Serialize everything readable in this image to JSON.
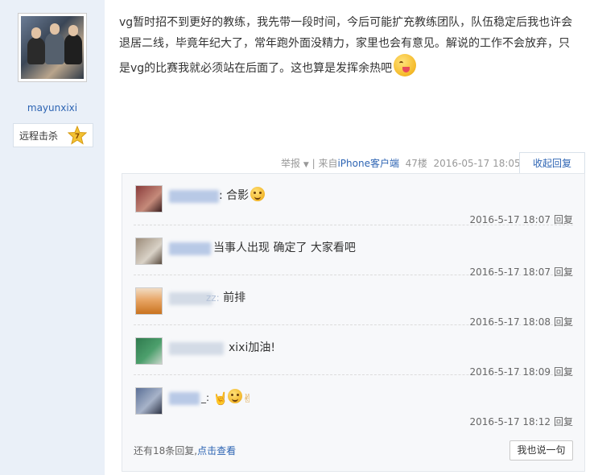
{
  "user": {
    "name": "mayunxixi",
    "badge_label": "远程击杀",
    "badge_level": "7"
  },
  "post": {
    "text": "vg暂时招不到更好的教练，我先带一段时间，今后可能扩充教练团队，队伍稳定后我也许会退居二线，毕竟年纪大了，常年跑外面没精力，家里也会有意见。解说的工作不会放弃，只是vg的比赛我就必须站在后面了。这也算是发挥余热吧"
  },
  "meta": {
    "report": "举报",
    "from_prefix": "| 来自",
    "client": "iPhone客户端",
    "floor": "47楼",
    "datetime": "2016-05-17 18:05",
    "collapse": "收起回复"
  },
  "replies": [
    {
      "suffix": ":",
      "text": " 合影",
      "emoji": "smile",
      "time": "2016-5-17 18:07",
      "reply": "回复"
    },
    {
      "suffix": "",
      "text": "当事人出现 确定了 大家看吧",
      "time": "2016-5-17 18:07",
      "reply": "回复"
    },
    {
      "suffix": "zz:",
      "text": " 前排",
      "time": "2016-5-17 18:08",
      "reply": "回复"
    },
    {
      "suffix": "xixi",
      "text": "加油!",
      "time": "2016-5-17 18:09",
      "reply": "回复"
    },
    {
      "suffix": "_:",
      "text": "",
      "emoji": "hands",
      "time": "2016-5-17 18:12",
      "reply": "回复"
    }
  ],
  "footer": {
    "more_prefix": "还有18条回复,",
    "more_link": "点击查看",
    "say_button": "我也说一句"
  },
  "colors": {
    "link": "#2d64b3",
    "sidebar_bg": "#eaf0f8",
    "reply_bg": "#f7f8fa"
  }
}
